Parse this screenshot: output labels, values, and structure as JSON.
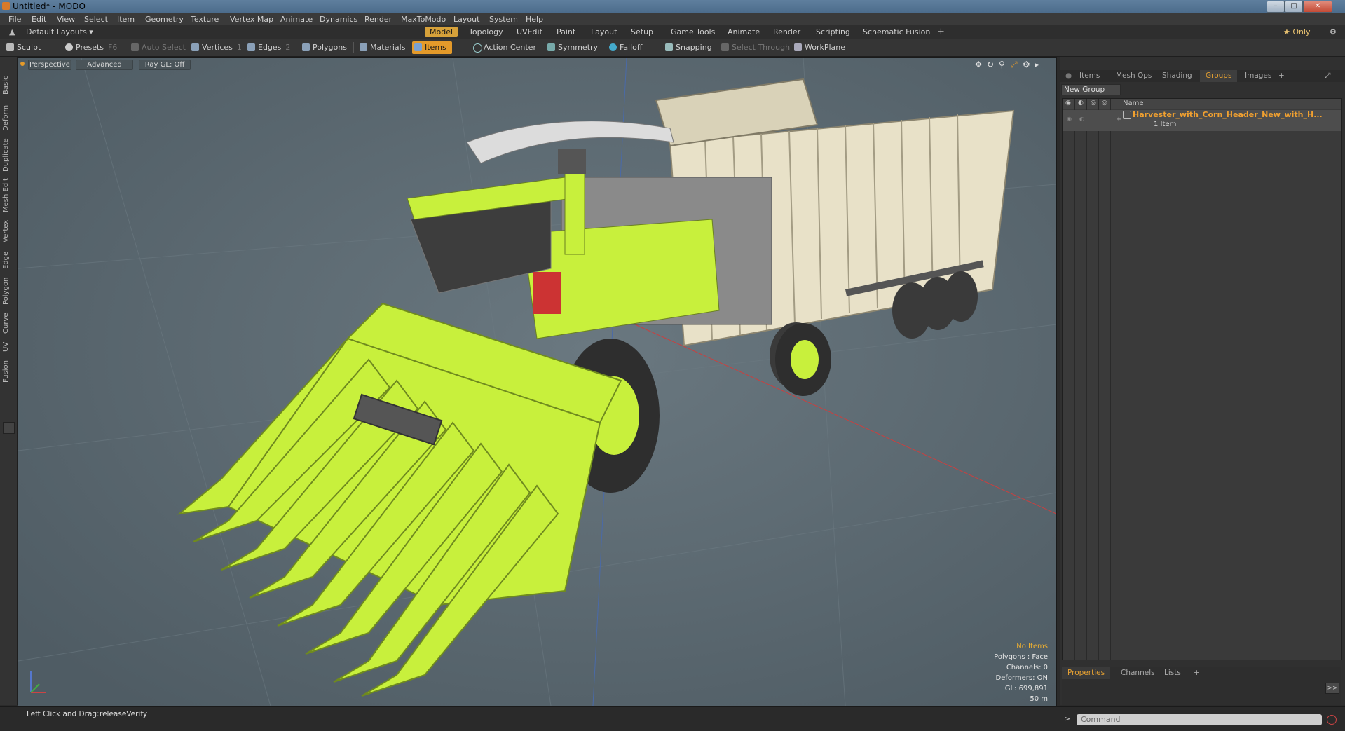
{
  "window": {
    "title": "Untitled* - MODO",
    "min": "–",
    "max": "□",
    "close": "✕"
  },
  "menu": [
    "File",
    "Edit",
    "View",
    "Select",
    "Item",
    "Geometry",
    "Texture",
    "Vertex Map",
    "Animate",
    "Dynamics",
    "Render",
    "MaxToModo",
    "Layout",
    "System",
    "Help"
  ],
  "layouts": {
    "default": "Default Layouts ▾",
    "tabs": [
      "Model",
      "Topology",
      "UVEdit",
      "Paint",
      "Layout",
      "Setup",
      "Game Tools",
      "Animate",
      "Render",
      "Scripting",
      "Schematic Fusion"
    ],
    "active": "Model",
    "add": "+",
    "only": "★ Only"
  },
  "toolbar": {
    "sculpt": "Sculpt",
    "presets": "Presets",
    "presets_key": "F6",
    "auto_select": "Auto Select",
    "vertices": "Vertices",
    "vertices_key": "1",
    "edges": "Edges",
    "edges_key": "2",
    "polygons": "Polygons",
    "materials": "Materials",
    "items": "Items",
    "action_center": "Action Center",
    "symmetry": "Symmetry",
    "falloff": "Falloff",
    "snapping": "Snapping",
    "select_through": "Select Through",
    "workplane": "WorkPlane"
  },
  "left_tabs": [
    "Basic",
    "Deform",
    "Duplicate",
    "Mesh Edit",
    "Vertex",
    "Edge",
    "Polygon",
    "Curve",
    "UV",
    "Fusion"
  ],
  "viewport": {
    "view": "Perspective",
    "shading": "Advanced",
    "raygl": "Ray GL: Off",
    "hud": {
      "items": "No Items",
      "polygons": "Polygons : Face",
      "channels": "Channels: 0",
      "deformers": "Deformers: ON",
      "gl": "GL: 699,891",
      "scale": "50 m"
    }
  },
  "right_panel": {
    "tabs": [
      "Items",
      "Mesh Ops",
      "Shading",
      "Groups",
      "Images"
    ],
    "active": "Groups",
    "add": "+",
    "new_group": "New Group",
    "col_name": "Name",
    "item_name": "Harvester_with_Corn_Header_New_with_H...",
    "item_count": "1 Item",
    "bottom_tabs": [
      "Properties",
      "Channels",
      "Lists"
    ],
    "bottom_active": "Properties",
    "arrow": ">>"
  },
  "status": {
    "hint_label": "Left Click and Drag:",
    "hint_value": "releaseVerify",
    "command_placeholder": "Command",
    "prompt": ">"
  },
  "colors": {
    "accent": "#e49a2a",
    "header_lime": "#c8f03c",
    "viewport_bg": "#5c6b74"
  }
}
